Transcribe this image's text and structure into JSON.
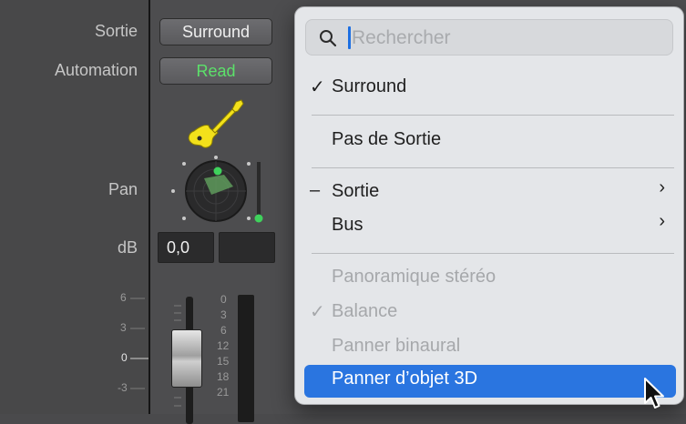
{
  "channel": {
    "labels": {
      "output": "Sortie",
      "automation": "Automation",
      "pan": "Pan",
      "db": "dB"
    },
    "output_button": "Surround",
    "automation_button": "Read",
    "db_value": "0,0",
    "fader_scale": [
      "6",
      "3",
      "0",
      "-3"
    ],
    "meter_scale": [
      "0",
      "3",
      "6",
      "12",
      "15",
      "18",
      "21"
    ]
  },
  "menu": {
    "search": {
      "placeholder": "Rechercher",
      "value": ""
    },
    "items": [
      {
        "label": "Surround",
        "check": "✓",
        "state": "checked"
      },
      {
        "label": "Pas de Sortie",
        "check": "",
        "state": "normal"
      },
      {
        "label": "Sortie",
        "check": "–",
        "state": "mixed",
        "submenu": "›"
      },
      {
        "label": "Bus",
        "check": "",
        "state": "normal",
        "submenu": "›"
      },
      {
        "label": "Panoramique stéréo",
        "check": "",
        "state": "disabled"
      },
      {
        "label": "Balance",
        "check": "✓",
        "state": "disabled"
      },
      {
        "label": "Panner binaural",
        "check": "",
        "state": "disabled"
      },
      {
        "label": "Panner d’objet 3D",
        "check": "",
        "state": "selected"
      }
    ]
  },
  "colors": {
    "accent": "#2a75e0",
    "automation_read": "#5ce16a",
    "instrument_icon": "#f3e11b",
    "pan_point": "#3fd25c"
  },
  "icons": {
    "search": "search-icon",
    "instrument": "guitar-icon",
    "cursor": "pointer-cursor-icon"
  }
}
